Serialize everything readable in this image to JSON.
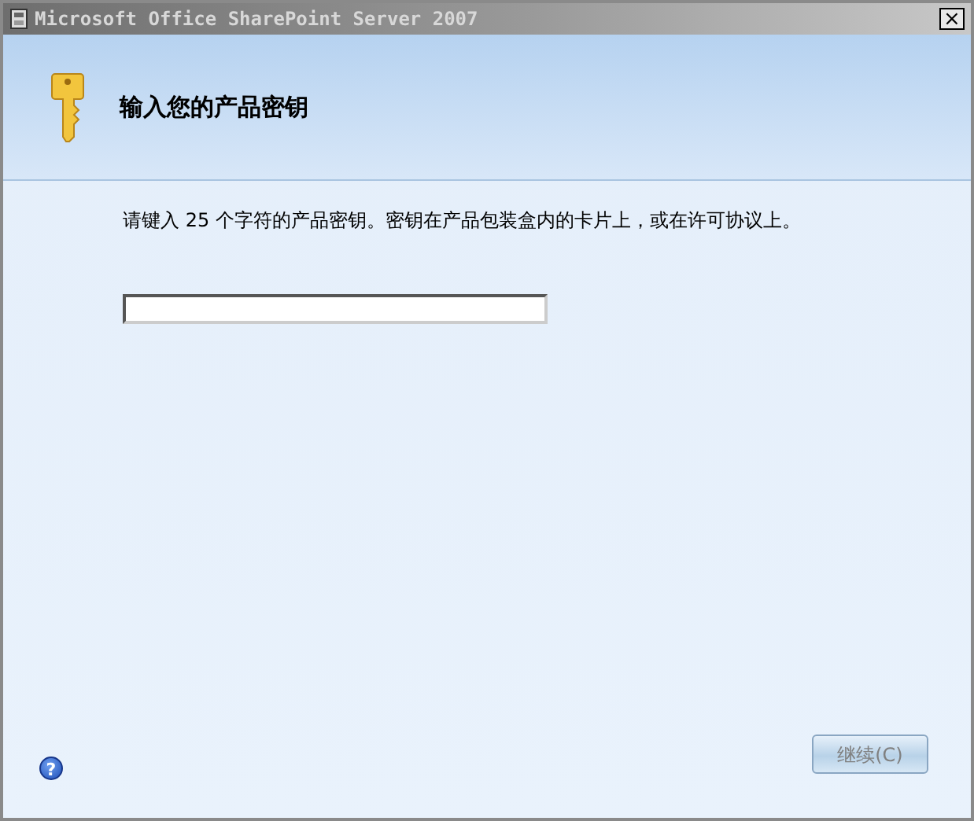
{
  "window": {
    "title": "Microsoft Office SharePoint Server 2007",
    "close": "×"
  },
  "header": {
    "title": "输入您的产品密钥"
  },
  "instruction": "请键入 25 个字符的产品密钥。密钥在产品包装盒内的卡片上，或在许可协议上。",
  "key_field": {
    "focused": true
  },
  "help": {
    "label": "?"
  },
  "buttons": [
    {
      "label": "继续(C)",
      "disabled": true
    }
  ]
}
